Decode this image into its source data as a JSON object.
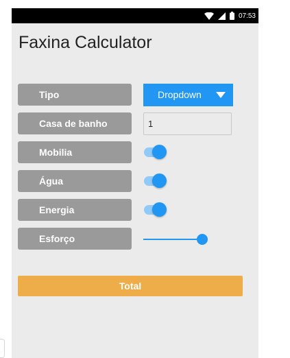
{
  "status_bar": {
    "time": "07:53",
    "icons": [
      "wifi-icon",
      "signal-icon",
      "battery-icon"
    ]
  },
  "app": {
    "title": "Faxina Calculator"
  },
  "form": {
    "tipo": {
      "label": "Tipo",
      "dropdown_value": "Dropdown"
    },
    "casa_de_banho": {
      "label": "Casa de banho",
      "value": "1"
    },
    "mobilia": {
      "label": "Mobilia",
      "on": true
    },
    "agua": {
      "label": "Água",
      "on": true
    },
    "energia": {
      "label": "Energia",
      "on": true
    },
    "esforco": {
      "label": "Esforço",
      "value_fraction": 0.9
    }
  },
  "actions": {
    "total_label": "Total"
  },
  "colors": {
    "accent": "#2196f3",
    "accent_light": "#90caf9",
    "label_bg": "#9a9a9a",
    "total_bg": "#efad4a",
    "screen_bg": "#ebebeb"
  }
}
